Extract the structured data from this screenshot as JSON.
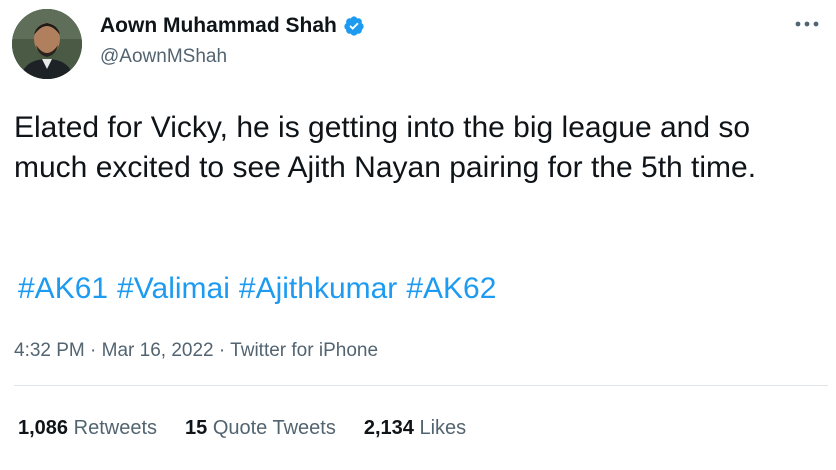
{
  "author": {
    "display_name": "Aown Muhammad Shah",
    "handle": "@AownMShah",
    "verified": true,
    "avatar_icon": "user-avatar-photo"
  },
  "tweet": {
    "text": "Elated for Vicky, he is getting into the big league and so much excited to see Ajith Nayan pairing for the 5th time.",
    "hashtags": [
      "#AK61",
      "#Valimai",
      "#Ajithkumar",
      "#AK62"
    ],
    "time": "4:32 PM",
    "separator": "·",
    "date": "Mar 16, 2022",
    "source": "Twitter for iPhone"
  },
  "stats": [
    {
      "count": "1,086",
      "label": "Retweets"
    },
    {
      "count": "15",
      "label": "Quote Tweets"
    },
    {
      "count": "2,134",
      "label": "Likes"
    }
  ],
  "colors": {
    "link": "#1d9bf0",
    "verified_badge": "#1d9bf0",
    "secondary_text": "#536471",
    "primary_text": "#0f1419"
  },
  "more_icon": "more-horizontal-icon"
}
